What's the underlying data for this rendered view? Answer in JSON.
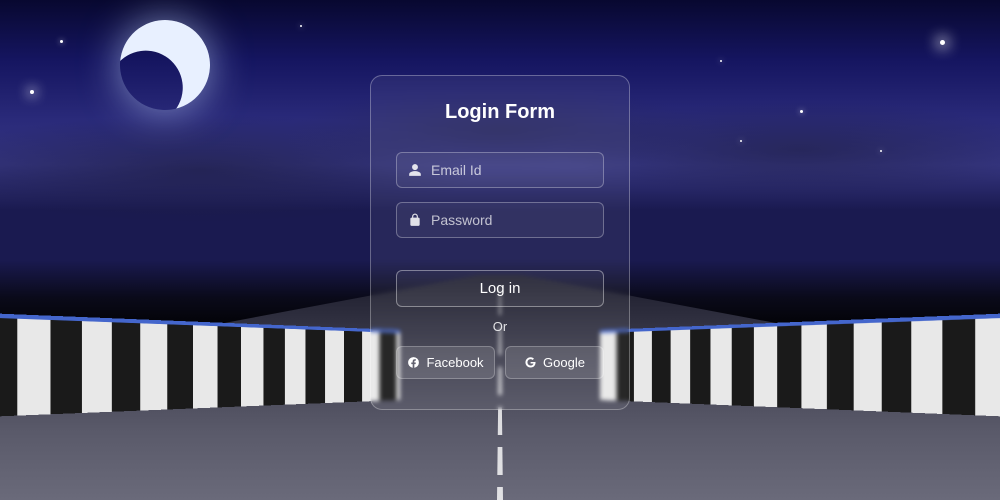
{
  "form": {
    "title": "Login Form",
    "email": {
      "placeholder": "Email Id",
      "value": ""
    },
    "password": {
      "placeholder": "Password",
      "value": ""
    },
    "login_label": "Log in",
    "or_label": "Or",
    "social": {
      "facebook_label": "Facebook",
      "google_label": "Google"
    }
  }
}
